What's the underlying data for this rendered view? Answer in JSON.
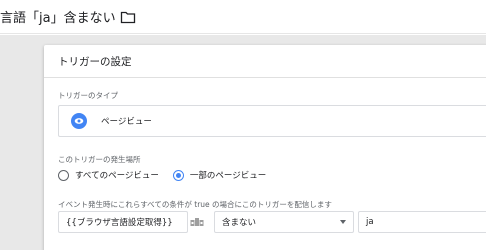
{
  "header": {
    "title": "言語「ja」含まない",
    "folder_icon": "folder-icon"
  },
  "card": {
    "title": "トリガーの設定",
    "trigger_type_label": "トリガーのタイプ",
    "trigger_type_value": "ページビュー",
    "trigger_type_icon": "eye-icon",
    "fires_on_label": "このトリガーの発生場所",
    "radio_all": "すべてのページビュー",
    "radio_some": "一部のページビュー",
    "radio_selected": "radio_some",
    "condition_label": "イベント発生時にこれらすべての条件が true の場合にこのトリガーを配信します",
    "condition": {
      "variable": "{{ブラウザ言語設定取得}}",
      "operator": "含まない",
      "value": "ja"
    }
  },
  "colors": {
    "accent": "#4285f4",
    "canvas": "#e8e8e8"
  }
}
